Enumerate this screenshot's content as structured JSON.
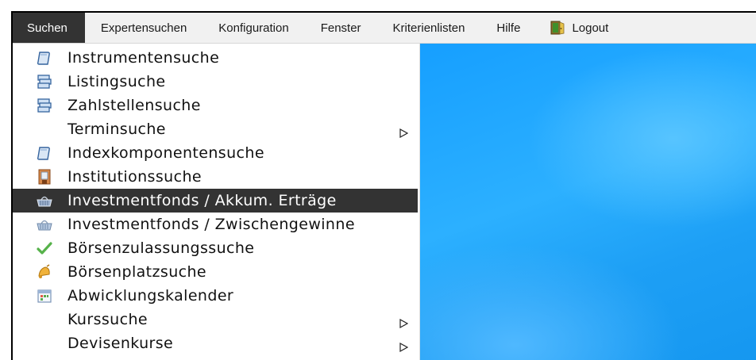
{
  "menubar": {
    "items": [
      {
        "label": "Suchen",
        "active": true
      },
      {
        "label": "Expertensuchen",
        "active": false
      },
      {
        "label": "Konfiguration",
        "active": false
      },
      {
        "label": "Fenster",
        "active": false
      },
      {
        "label": "Kriterienlisten",
        "active": false
      },
      {
        "label": "Hilfe",
        "active": false
      }
    ],
    "logout": {
      "label": "Logout",
      "icon": "logout-door-icon"
    }
  },
  "dropdown": {
    "items": [
      {
        "label": "Instrumentensuche",
        "icon": "document-icon",
        "submenu": false,
        "highlighted": false
      },
      {
        "label": "Listingsuche",
        "icon": "stacked-windows-icon",
        "submenu": false,
        "highlighted": false
      },
      {
        "label": "Zahlstellensuche",
        "icon": "stacked-windows-icon",
        "submenu": false,
        "highlighted": false
      },
      {
        "label": "Terminsuche",
        "icon": "",
        "submenu": true,
        "highlighted": false
      },
      {
        "label": "Indexkomponentensuche",
        "icon": "document-icon",
        "submenu": false,
        "highlighted": false
      },
      {
        "label": "Institutionssuche",
        "icon": "building-icon",
        "submenu": false,
        "highlighted": false
      },
      {
        "label": "Investmentfonds / Akkum. Erträge",
        "icon": "basket-icon",
        "submenu": false,
        "highlighted": true
      },
      {
        "label": "Investmentfonds / Zwischengewinne",
        "icon": "basket-icon",
        "submenu": false,
        "highlighted": false
      },
      {
        "label": "Börsenzulassungssuche",
        "icon": "checkmark-icon",
        "submenu": false,
        "highlighted": false
      },
      {
        "label": "Börsenplatzsuche",
        "icon": "bell-icon",
        "submenu": false,
        "highlighted": false
      },
      {
        "label": "Abwicklungskalender",
        "icon": "calendar-icon",
        "submenu": false,
        "highlighted": false
      },
      {
        "label": "Kurssuche",
        "icon": "",
        "submenu": true,
        "highlighted": false
      },
      {
        "label": "Devisenkurse",
        "icon": "",
        "submenu": true,
        "highlighted": false
      }
    ]
  },
  "colors": {
    "menubar_bg": "#f1f1f1",
    "active_bg": "#333333",
    "desktop_blue": "#1d9ff5"
  }
}
